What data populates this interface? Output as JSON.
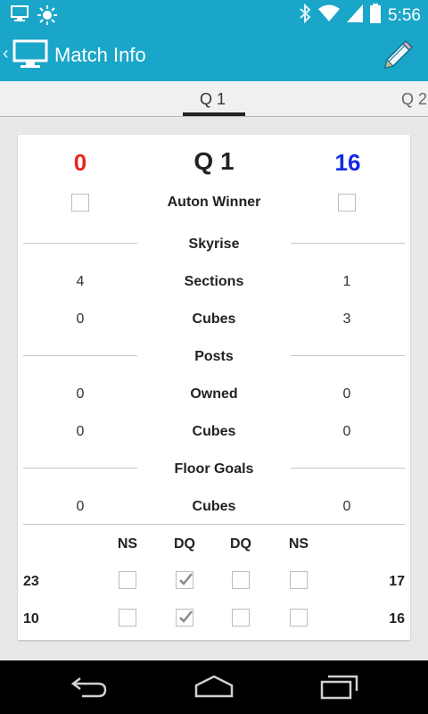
{
  "status_bar": {
    "time": "5:56",
    "icons": [
      "monitor-icon",
      "brightness-icon",
      "bluetooth-icon",
      "wifi-icon",
      "signal-icon",
      "battery-icon"
    ]
  },
  "action_bar": {
    "title": "Match Info",
    "icons": [
      "monitor-icon",
      "pencil-icon"
    ],
    "color": "#1aa6c9"
  },
  "tabs": [
    {
      "label": "Q 1",
      "selected": true
    },
    {
      "label": "Q 2",
      "selected": false
    }
  ],
  "match": {
    "title": "Q 1",
    "red_score": "0",
    "blue_score": "16",
    "red_color": "#e8261d",
    "blue_color": "#1428e6",
    "auton_label": "Auton Winner",
    "auton_red_checked": false,
    "auton_blue_checked": false,
    "sections": [
      {
        "header": "Skyrise",
        "rows": [
          {
            "label": "Sections",
            "red": "4",
            "blue": "1"
          },
          {
            "label": "Cubes",
            "red": "0",
            "blue": "3"
          }
        ]
      },
      {
        "header": "Posts",
        "rows": [
          {
            "label": "Owned",
            "red": "0",
            "blue": "0"
          },
          {
            "label": "Cubes",
            "red": "0",
            "blue": "0"
          }
        ]
      },
      {
        "header": "Floor Goals",
        "rows": [
          {
            "label": "Cubes",
            "red": "0",
            "blue": "0"
          }
        ]
      }
    ],
    "penalty_headers": [
      "NS",
      "DQ",
      "DQ",
      "NS"
    ],
    "teams": [
      {
        "red_team": "23",
        "blue_team": "17",
        "checks": [
          false,
          true,
          false,
          false
        ]
      },
      {
        "red_team": "10",
        "blue_team": "16",
        "checks": [
          false,
          true,
          false,
          false
        ]
      }
    ]
  },
  "nav_bar": {
    "icons": [
      "back-icon",
      "home-icon",
      "recent-apps-icon"
    ]
  }
}
